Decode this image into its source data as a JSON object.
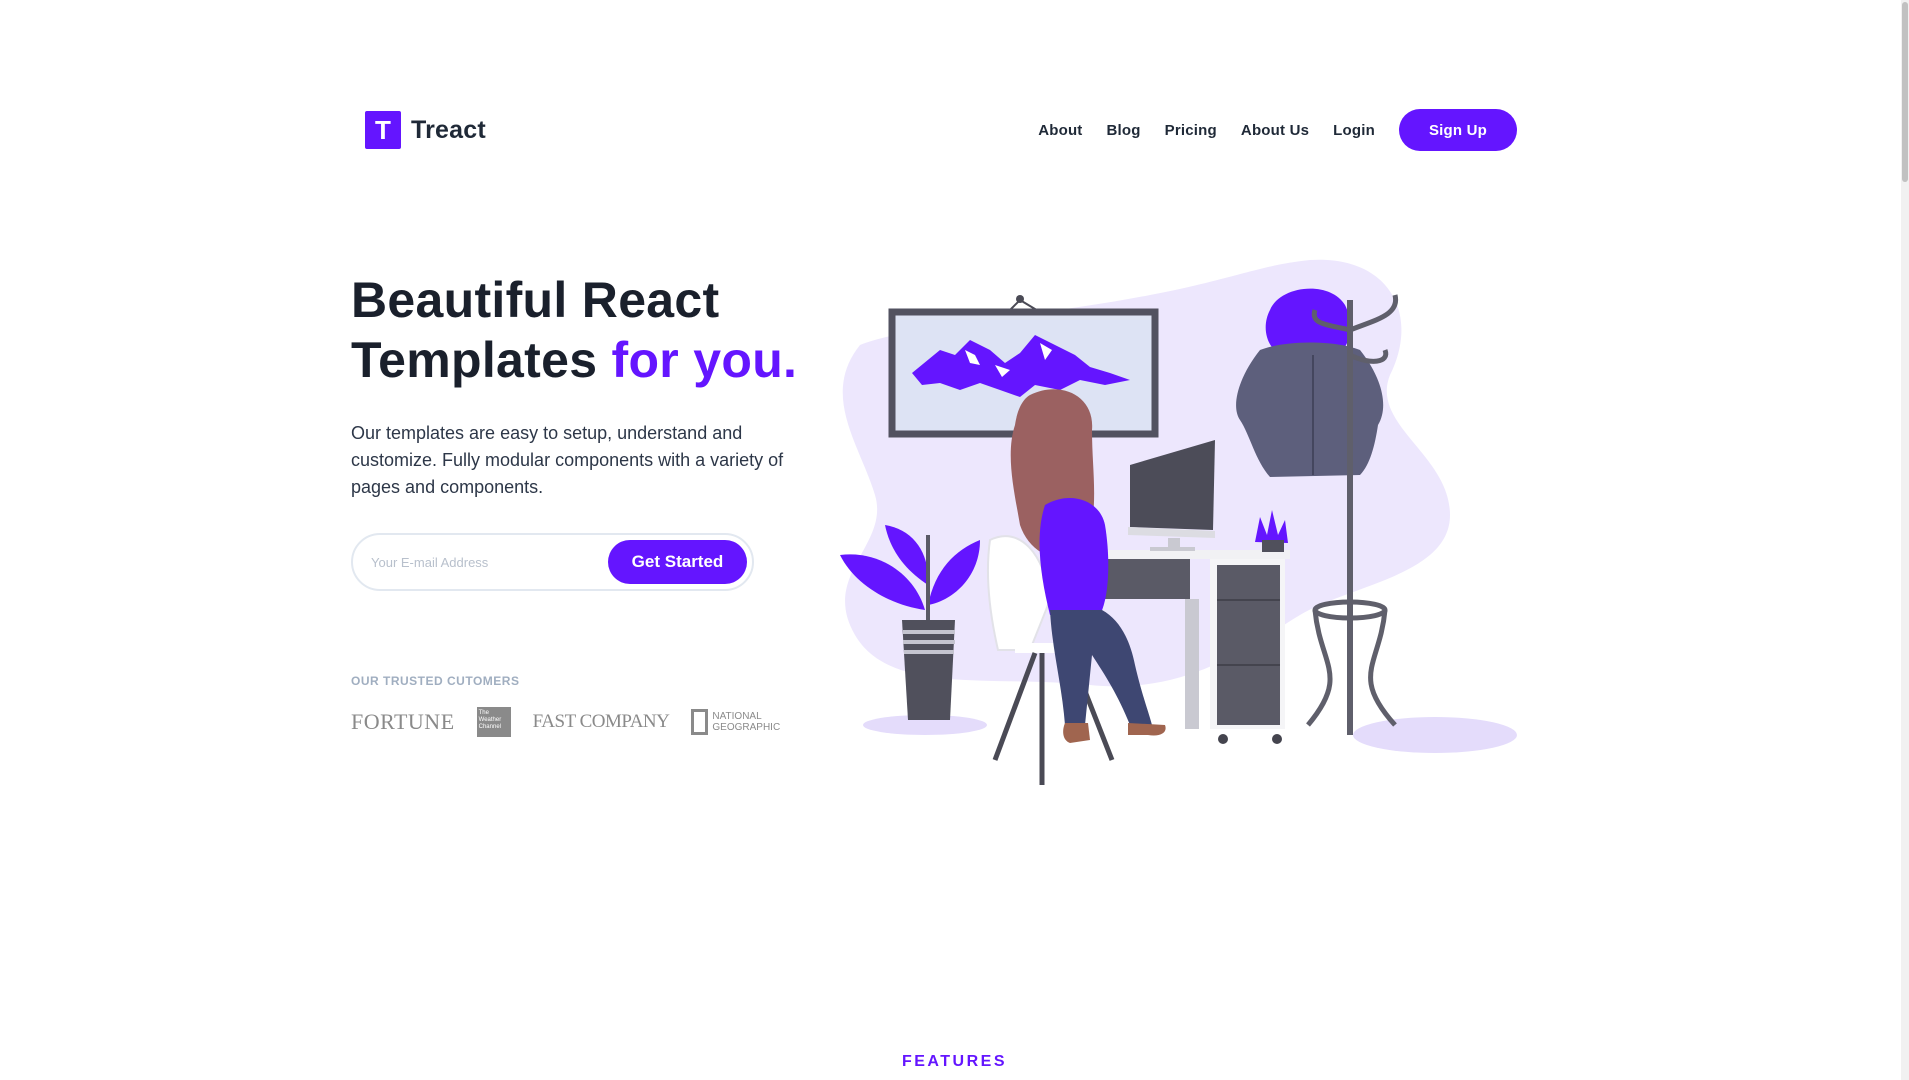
{
  "brand": {
    "logo_letter": "T",
    "name": "Treact",
    "accent_color": "#6415ff"
  },
  "nav": {
    "items": [
      {
        "label": "About"
      },
      {
        "label": "Blog"
      },
      {
        "label": "Pricing"
      },
      {
        "label": "About Us"
      },
      {
        "label": "Login"
      }
    ],
    "signup_label": "Sign Up"
  },
  "hero": {
    "title_line1": "Beautiful React",
    "title_line2": "Templates",
    "title_accent": "for you.",
    "description": "Our templates are easy to setup, understand and customize. Fully modular components with a variety of pages and components.",
    "email_placeholder": "Your E-mail Address",
    "cta_label": "Get Started"
  },
  "customers": {
    "label": "OUR TRUSTED CUTOMERS",
    "logos": [
      {
        "text": "FORTUNE"
      },
      {
        "text": "The Weather Channel"
      },
      {
        "text": "FAST COMPANY"
      },
      {
        "text": "NATIONAL GEOGRAPHIC"
      }
    ]
  },
  "illustration": {
    "icon": "woman-at-desk-illustration"
  },
  "features": {
    "label": "FEATURES"
  }
}
